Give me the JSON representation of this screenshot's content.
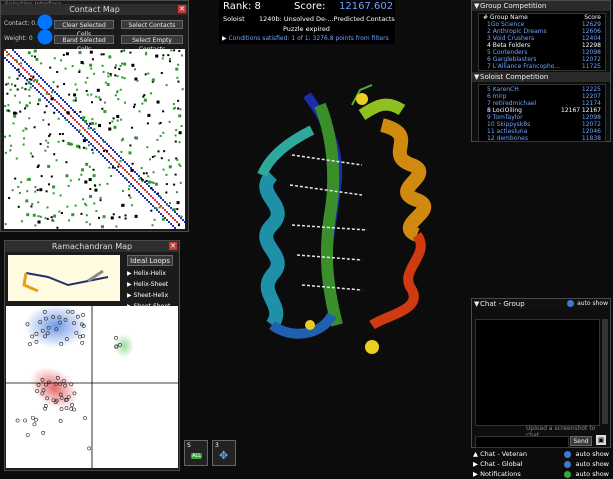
{
  "selection_bar": {
    "label": "Selection Interface"
  },
  "contact_map": {
    "title": "Contact Map",
    "contact_label": "Contact: 0.0",
    "weight_label": "Weight: 0",
    "buttons": [
      "Clear Selected Cells",
      "Select Contacts",
      "Band Selected Cells",
      "Select Empty Contacts"
    ]
  },
  "rama": {
    "title": "Ramachandran Map",
    "ideal_loops": "Ideal Loops",
    "options": [
      "Helix-Helix",
      "Helix-Sheet",
      "Sheet-Helix",
      "Sheet-Sheet"
    ]
  },
  "header": {
    "rank_label": "Rank: 8",
    "score_label": "Score:",
    "score_value": "12167.602",
    "role": "Soloist",
    "puzzle_title": "1240b: Unsolved De-...Predicted Contacts",
    "puzzle_status": "Puzzle expired",
    "conditions": "Conditions satisfied: 1 of 1; 3276.8 points from filters"
  },
  "group_comp": {
    "title": "Group Competition",
    "col_name": "# Group Name",
    "col_score": "Score",
    "rows": [
      {
        "name": "1Go Science",
        "score": "12629",
        "hl": false
      },
      {
        "name": "2 Anthropic Dreams",
        "score": "12606",
        "hl": false
      },
      {
        "name": "3 Void Crushers",
        "score": "12404",
        "hl": false
      },
      {
        "name": "4 Beta Folders",
        "score": "12298",
        "hl": true
      },
      {
        "name": "5 Contenders",
        "score": "12098",
        "hl": false
      },
      {
        "name": "6 Gargleblasters",
        "score": "12072",
        "hl": false
      },
      {
        "name": "7 L'Alliance Francopho...",
        "score": "11725",
        "hl": false
      }
    ]
  },
  "solo_comp": {
    "title": "Soloist Competition",
    "rows": [
      {
        "name": "5 KarenCH",
        "mid": "",
        "score": "12225",
        "hl": false
      },
      {
        "name": "6 mirp",
        "mid": "",
        "score": "12207",
        "hl": false
      },
      {
        "name": "7 retiredmichael",
        "mid": "",
        "score": "12174",
        "hl": false
      },
      {
        "name": "8 LociOiling",
        "mid": "12167",
        "score": "12167",
        "hl": true
      },
      {
        "name": "9 TomTaylor",
        "mid": "",
        "score": "12098",
        "hl": false
      },
      {
        "name": "10 Skippysk8s",
        "mid": "",
        "score": "12072",
        "hl": false
      },
      {
        "name": "11 actiasluna",
        "mid": "",
        "score": "12046",
        "hl": false
      },
      {
        "name": "12 dembones",
        "mid": "",
        "score": "11838",
        "hl": false
      }
    ]
  },
  "chat": {
    "group_title": "Chat - Group",
    "auto_show": "auto show",
    "upload_hint": "Upload a screenshot to chat.",
    "send": "Send",
    "veteran": "Chat - Veteran",
    "global": "Chat - Global",
    "notifications": "Notifications"
  },
  "tools": {
    "s_label": "S",
    "n_label": "3",
    "all_label": "ALL"
  },
  "colors": {
    "accent_blue": "#6fa3ff",
    "panel_bg": "#1b1b1b",
    "close_red": "#cc3b3b"
  }
}
